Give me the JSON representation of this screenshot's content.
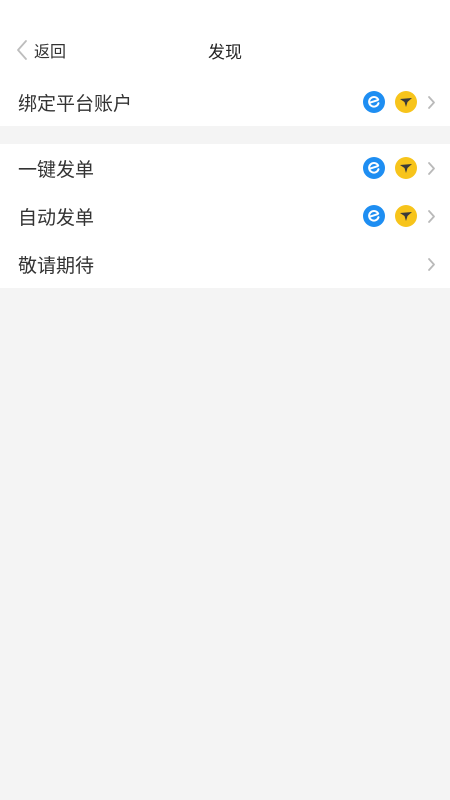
{
  "nav": {
    "back_label": "返回",
    "title": "发现"
  },
  "groups": [
    {
      "items": [
        {
          "label": "绑定平台账户",
          "icons": [
            "ele-me-icon",
            "meituan-icon"
          ]
        }
      ]
    },
    {
      "items": [
        {
          "label": "一键发单",
          "icons": [
            "ele-me-icon",
            "meituan-icon"
          ]
        },
        {
          "label": "自动发单",
          "icons": [
            "ele-me-icon",
            "meituan-icon"
          ]
        },
        {
          "label": "敬请期待",
          "icons": []
        }
      ]
    }
  ],
  "colors": {
    "ele_blue": "#1e8ef2",
    "meituan_yellow": "#f7c41b",
    "chevron_gray": "#b9b9b9",
    "page_bg": "#f4f4f4"
  }
}
